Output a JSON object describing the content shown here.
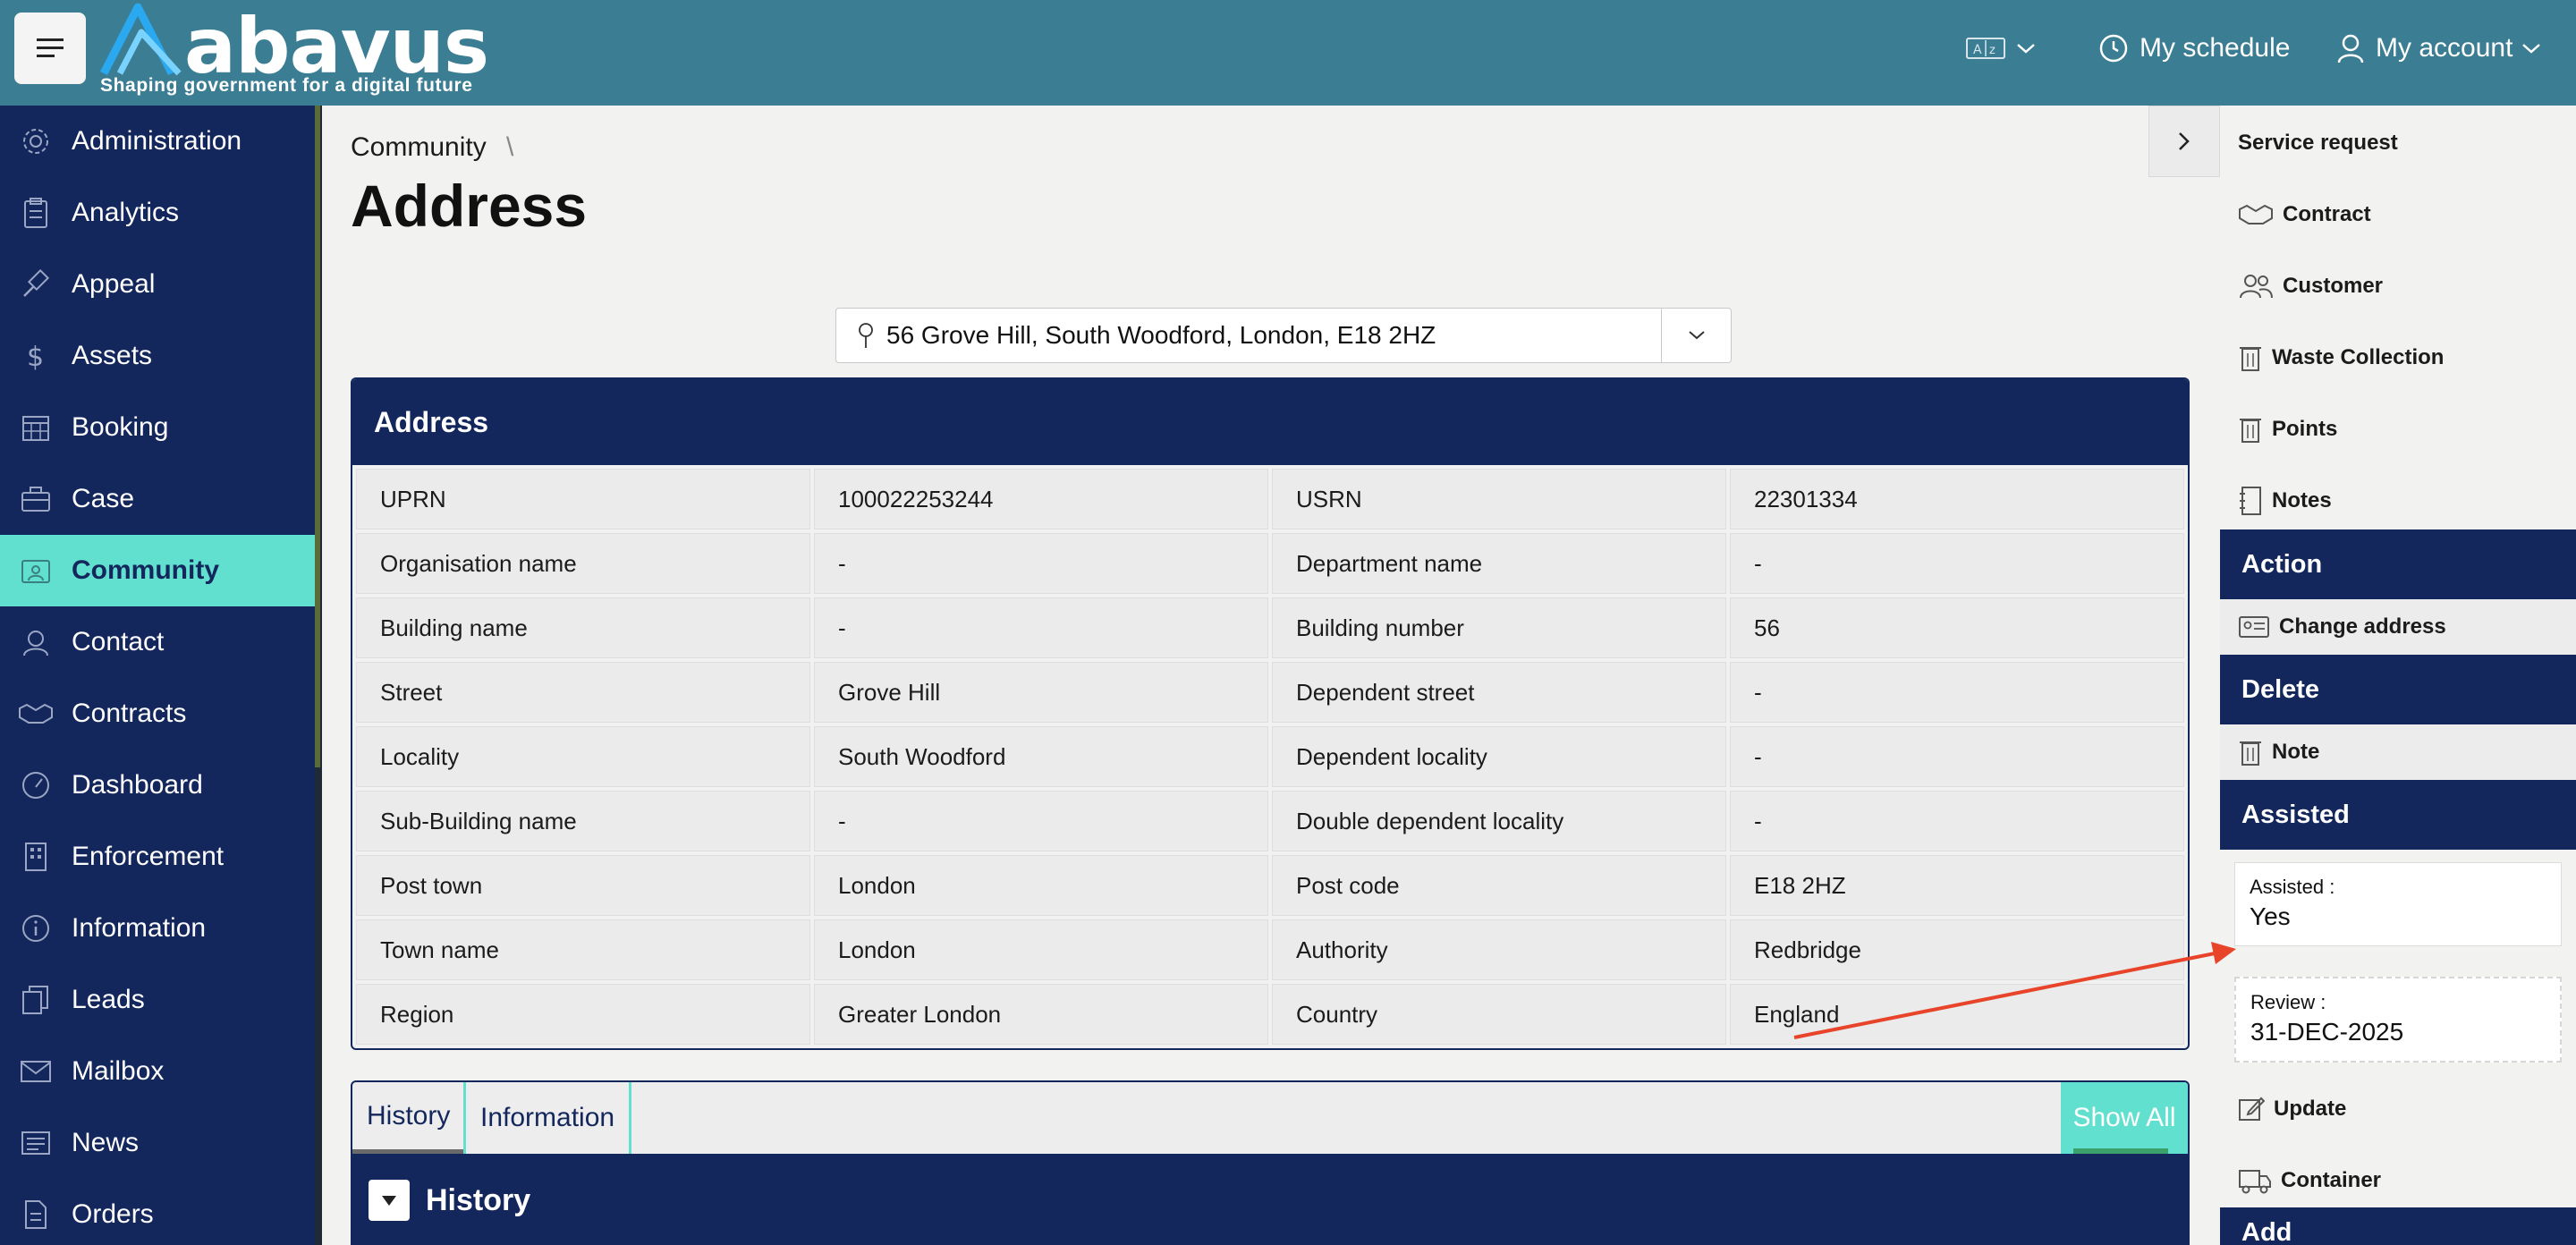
{
  "header": {
    "brand": "abavus",
    "tagline": "Shaping government for a digital future",
    "schedule_label": "My schedule",
    "account_label": "My account"
  },
  "sidebar": {
    "items": [
      {
        "label": "Administration",
        "icon": "gear-icon"
      },
      {
        "label": "Analytics",
        "icon": "clipboard-icon"
      },
      {
        "label": "Appeal",
        "icon": "gavel-icon"
      },
      {
        "label": "Assets",
        "icon": "dollar-icon"
      },
      {
        "label": "Booking",
        "icon": "calendar-icon"
      },
      {
        "label": "Case",
        "icon": "briefcase-icon"
      },
      {
        "label": "Community",
        "icon": "id-card-icon",
        "active": true
      },
      {
        "label": "Contact",
        "icon": "headset-icon"
      },
      {
        "label": "Contracts",
        "icon": "handshake-icon"
      },
      {
        "label": "Dashboard",
        "icon": "gauge-icon"
      },
      {
        "label": "Enforcement",
        "icon": "building-icon"
      },
      {
        "label": "Information",
        "icon": "info-icon"
      },
      {
        "label": "Leads",
        "icon": "copy-icon"
      },
      {
        "label": "Mailbox",
        "icon": "mail-icon"
      },
      {
        "label": "News",
        "icon": "news-icon"
      },
      {
        "label": "Orders",
        "icon": "document-icon"
      }
    ]
  },
  "breadcrumb": {
    "parent": "Community",
    "separator": "\\"
  },
  "page": {
    "title": "Address"
  },
  "address_select": {
    "value": "56 Grove Hill, South Woodford, London, E18 2HZ"
  },
  "address_card": {
    "title": "Address",
    "rows": [
      [
        "UPRN",
        "100022253244",
        "USRN",
        "22301334"
      ],
      [
        "Organisation name",
        "-",
        "Department name",
        "-"
      ],
      [
        "Building name",
        "-",
        "Building number",
        "56"
      ],
      [
        "Street",
        "Grove Hill",
        "Dependent street",
        "-"
      ],
      [
        "Locality",
        "South Woodford",
        "Dependent locality",
        "-"
      ],
      [
        "Sub-Building name",
        "-",
        "Double dependent locality",
        "-"
      ],
      [
        "Post town",
        "London",
        "Post code",
        "E18 2HZ"
      ],
      [
        "Town name",
        "London",
        "Authority",
        "Redbridge"
      ],
      [
        "Region",
        "Greater London",
        "Country",
        "England"
      ]
    ]
  },
  "tabs": {
    "history": "History",
    "information": "Information",
    "show_all": "Show All",
    "section_title": "History"
  },
  "right_panel": {
    "links": [
      {
        "label": "Service request"
      },
      {
        "label": "Contract"
      },
      {
        "label": "Customer"
      },
      {
        "label": "Waste Collection"
      },
      {
        "label": "Points"
      },
      {
        "label": "Notes"
      }
    ],
    "action_head": "Action",
    "change_address": "Change address",
    "delete_head": "Delete",
    "note": "Note",
    "assisted_head": "Assisted",
    "assisted_label": "Assisted :",
    "assisted_value": "Yes",
    "review_label": "Review :",
    "review_value": "31-DEC-2025",
    "update": "Update",
    "container": "Container",
    "add_head": "Add"
  },
  "colors": {
    "topbar": "#3b7d93",
    "navy": "#13275c",
    "accent": "#62e0cf",
    "annotation_arrow": "#e8442a"
  }
}
